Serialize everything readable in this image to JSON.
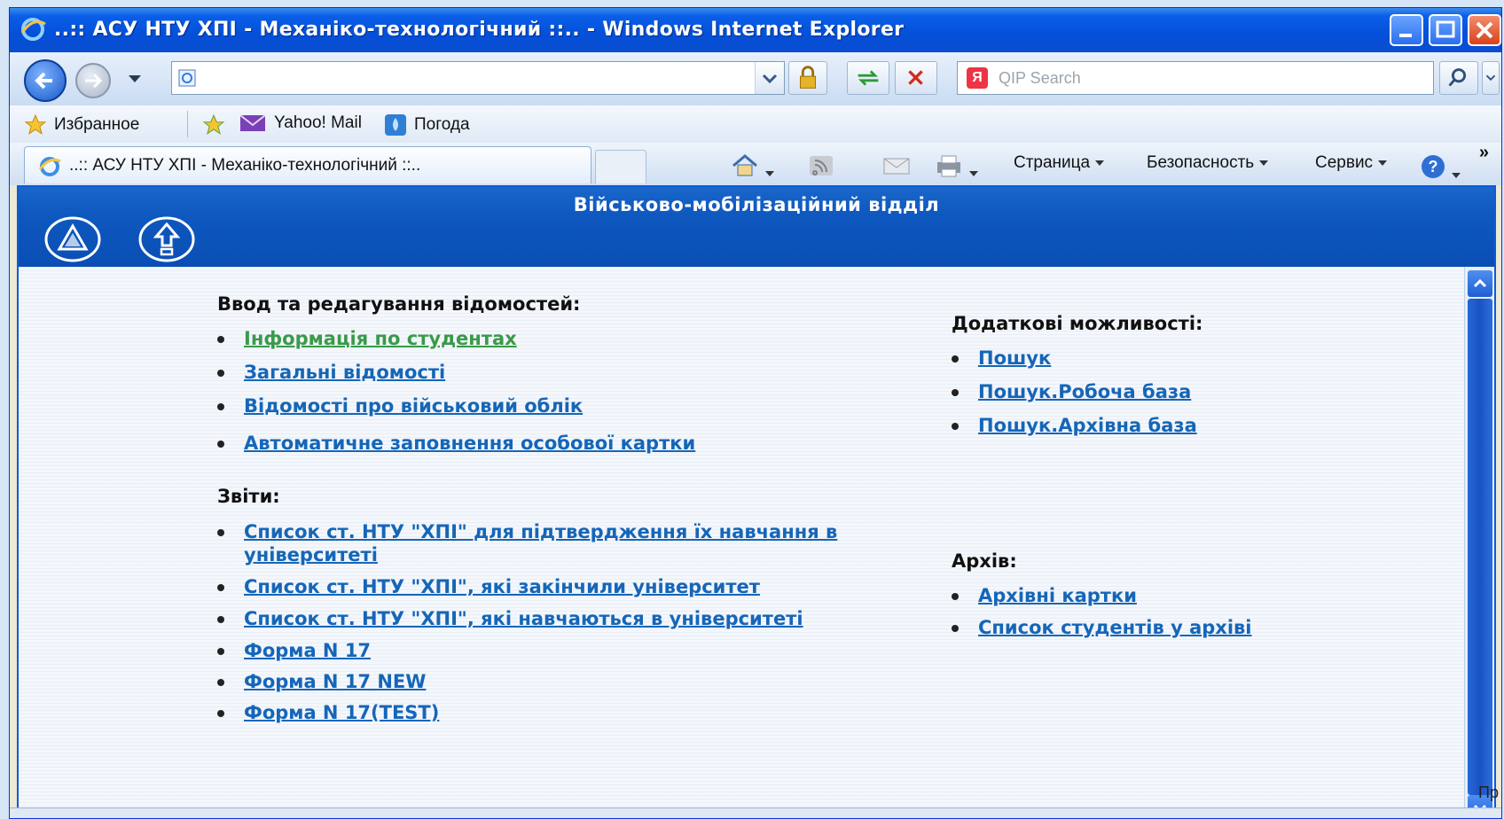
{
  "window": {
    "title": "..:: АСУ НТУ ХПІ - Механіко-технологічний ::.. - Windows Internet Explorer"
  },
  "toolbar": {
    "address_value": "",
    "search_placeholder": "QIP Search",
    "search_engine_letter": "Я"
  },
  "favorites": {
    "items": [
      {
        "label": "Избранное",
        "icon": "star-icon"
      },
      {
        "label": "Yahoo! Mail",
        "icon": "mail-icon"
      },
      {
        "label": "Погода",
        "icon": "weather-icon"
      }
    ]
  },
  "tabs": [
    {
      "label": "..:: АСУ НТУ ХПІ - Механіко-технологічний ::.."
    }
  ],
  "commands": {
    "page": "Страница",
    "safety": "Безопасность",
    "service": "Сервис",
    "more": "»"
  },
  "page": {
    "title": "Військово-мобілізаційний відділ",
    "left": {
      "input_heading": "Ввод та редагування відомостей:",
      "input_links": [
        "Інформація по студентах",
        "Загальні відомості",
        "Відомості про військовий облік",
        "Автоматичне заповнення особової картки"
      ],
      "reports_heading": "Звіти:",
      "report_links": [
        "Список ст. НТУ \"ХПІ\" для підтвердження їх навчання в університеті",
        "Список ст. НТУ \"ХПІ\", які закінчили університет",
        "Список ст. НТУ \"ХПІ\", які навчаються в університеті",
        "Форма N 17",
        "Форма N 17 NEW",
        "Форма N 17(TEST)"
      ]
    },
    "right": {
      "extra_heading": "Додаткові можливості:",
      "extra_links": [
        "Пошук",
        "Пошук.Робоча база",
        "Пошук.Архівна база"
      ],
      "archive_heading": "Архів:",
      "archive_links": [
        "Архівні картки",
        "Список студентів у архіві"
      ]
    },
    "corner_text": "Пр"
  },
  "colors": {
    "link": "#1566b8",
    "visited_link": "#3a9a4a",
    "banner": "#0e58bf",
    "titlebar": "#0450d8"
  }
}
